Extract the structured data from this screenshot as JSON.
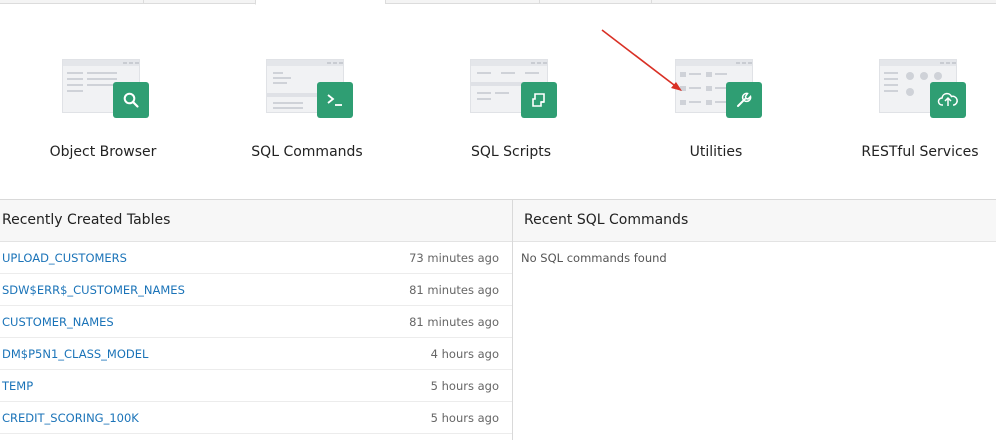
{
  "tiles": [
    {
      "label": "Object Browser",
      "icon": "magnifier-icon"
    },
    {
      "label": "SQL Commands",
      "icon": "terminal-prompt-icon"
    },
    {
      "label": "SQL Scripts",
      "icon": "script-scroll-icon"
    },
    {
      "label": "Utilities",
      "icon": "wrench-icon"
    },
    {
      "label": "RESTful Services",
      "icon": "cloud-upload-icon"
    }
  ],
  "recent_tables": {
    "title": "Recently Created Tables",
    "rows": [
      {
        "name": "UPLOAD_CUSTOMERS",
        "time": "73 minutes ago"
      },
      {
        "name": "SDW$ERR$_CUSTOMER_NAMES",
        "time": "81 minutes ago"
      },
      {
        "name": "CUSTOMER_NAMES",
        "time": "81 minutes ago"
      },
      {
        "name": "DM$P5N1_CLASS_MODEL",
        "time": "4 hours ago"
      },
      {
        "name": "TEMP",
        "time": "5 hours ago"
      },
      {
        "name": "CREDIT_SCORING_100K",
        "time": "5 hours ago"
      }
    ]
  },
  "recent_sql": {
    "title": "Recent SQL Commands",
    "empty_text": "No SQL commands found"
  },
  "colors": {
    "accent_green": "#2f9e73",
    "link_blue": "#1a73b8",
    "annotation_arrow": "#d93025"
  }
}
